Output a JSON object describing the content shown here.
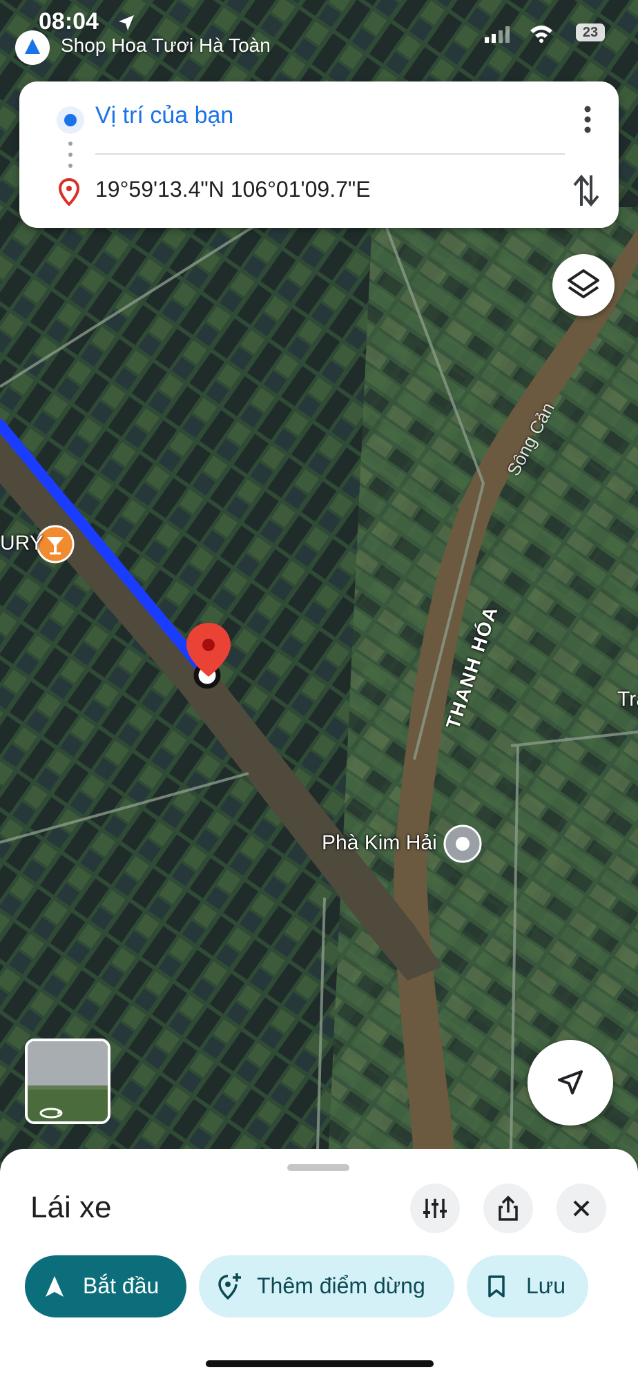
{
  "status_bar": {
    "time": "08:04",
    "back_app": "Shop Hoa Tươi Hà Toàn",
    "battery": "23"
  },
  "directions": {
    "origin": "Vị trí của bạn",
    "destination": "19°59'13.4\"N 106°01'09.7\"E"
  },
  "map_labels": {
    "poi_bar": "URY",
    "poi_ferry": "Phà Kim Hải",
    "river": "Sông Cản",
    "province": "THANH HÓA",
    "edge_label": "Tra"
  },
  "bottom_sheet": {
    "mode": "Lái xe",
    "start_label": "Bắt đầu",
    "add_stop_label": "Thêm điểm dừng",
    "save_label": "Lưu"
  },
  "colors": {
    "route": "#1a3cff",
    "accent_blue": "#1a73e8",
    "start_button": "#0b6e7a",
    "pill_light": "#d5f1f8",
    "pin_red": "#ea4335"
  }
}
